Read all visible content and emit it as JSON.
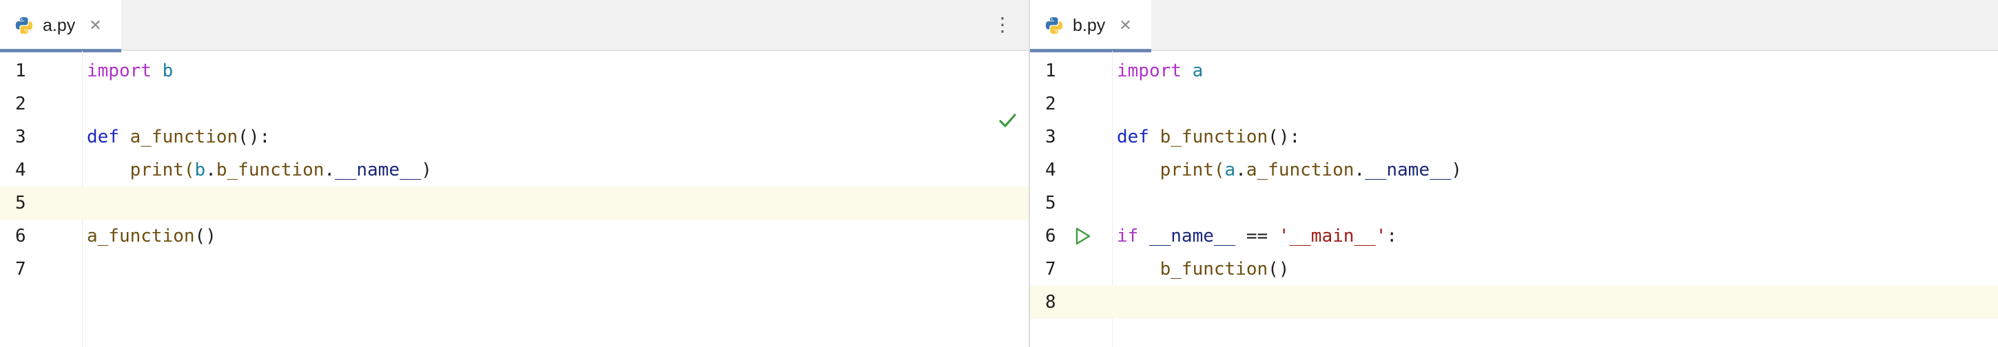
{
  "left_pane": {
    "tab": {
      "filename": "a.py",
      "icon": "python-file-icon",
      "close": "✕"
    },
    "menu_glyph": "⋮",
    "status_icon": "check-icon",
    "lines": [
      {
        "n": "1",
        "tokens": [
          [
            "import",
            "kw"
          ],
          [
            " ",
            "plain"
          ],
          [
            "b",
            "mod"
          ]
        ]
      },
      {
        "n": "2",
        "tokens": []
      },
      {
        "n": "3",
        "tokens": [
          [
            "def",
            "kw2"
          ],
          [
            " ",
            "plain"
          ],
          [
            "a_function",
            "fn"
          ],
          [
            "():",
            "plain"
          ]
        ]
      },
      {
        "n": "4",
        "tokens": [
          [
            "    print(",
            "fn"
          ],
          [
            "b",
            "mod"
          ],
          [
            ".",
            "plain"
          ],
          [
            "b_function",
            "fn"
          ],
          [
            ".",
            "plain"
          ],
          [
            "__name__",
            "dunder"
          ],
          [
            ")",
            "plain"
          ]
        ]
      },
      {
        "n": "5",
        "tokens": [],
        "current": true
      },
      {
        "n": "6",
        "tokens": [
          [
            "a_function",
            "fn"
          ],
          [
            "()",
            "plain"
          ]
        ]
      },
      {
        "n": "7",
        "tokens": []
      }
    ]
  },
  "right_pane": {
    "tab": {
      "filename": "b.py",
      "icon": "python-file-icon",
      "close": "✕"
    },
    "lines": [
      {
        "n": "1",
        "tokens": [
          [
            "import",
            "kw"
          ],
          [
            " ",
            "plain"
          ],
          [
            "a",
            "mod"
          ]
        ]
      },
      {
        "n": "2",
        "tokens": []
      },
      {
        "n": "3",
        "tokens": [
          [
            "def",
            "kw2"
          ],
          [
            " ",
            "plain"
          ],
          [
            "b_function",
            "fn"
          ],
          [
            "():",
            "plain"
          ]
        ]
      },
      {
        "n": "4",
        "tokens": [
          [
            "    print(",
            "fn"
          ],
          [
            "a",
            "mod"
          ],
          [
            ".",
            "plain"
          ],
          [
            "a_function",
            "fn"
          ],
          [
            ".",
            "plain"
          ],
          [
            "__name__",
            "dunder"
          ],
          [
            ")",
            "plain"
          ]
        ]
      },
      {
        "n": "5",
        "tokens": []
      },
      {
        "n": "6",
        "tokens": [
          [
            "if",
            "kw"
          ],
          [
            " ",
            "plain"
          ],
          [
            "__name__",
            "dunder"
          ],
          [
            " == ",
            "plain"
          ],
          [
            "'__main__'",
            "str"
          ],
          [
            ":",
            "plain"
          ]
        ],
        "run": true
      },
      {
        "n": "7",
        "tokens": [
          [
            "    b_function",
            "fn"
          ],
          [
            "()",
            "plain"
          ]
        ]
      },
      {
        "n": "8",
        "tokens": [],
        "current": true
      }
    ]
  },
  "colors": {
    "keyword": "#b032c8",
    "def_keyword": "#1a27c4",
    "module": "#1c7fa0",
    "function": "#6d4f12",
    "dunder": "#1a2878",
    "string": "#a01b17",
    "current_line": "#fcfae9",
    "tab_underline": "#6c87b4",
    "run_green": "#3f9a3f"
  }
}
